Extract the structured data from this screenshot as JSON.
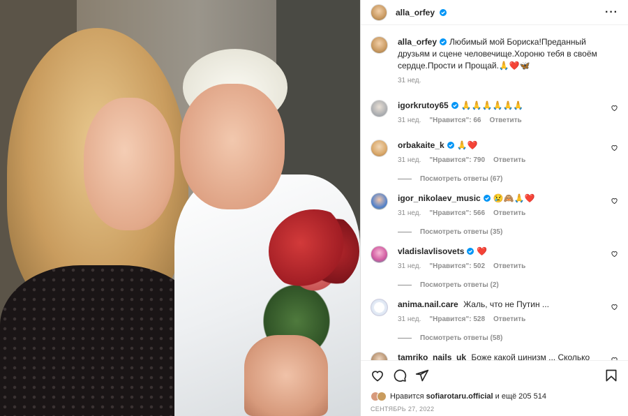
{
  "header": {
    "username": "alla_orfey",
    "more_icon": "more-horizontal-icon"
  },
  "caption": {
    "username": "alla_orfey",
    "text": "Любимый мой Бориска!Преданный друзьям и сцене человечище.Хороню тебя в своём сердце.Прости и Прощай.🙏❤️🦋",
    "time": "31 нед."
  },
  "comments": [
    {
      "username": "igorkrutoy65",
      "verified": true,
      "text": "🙏🙏🙏🙏🙏🙏",
      "time": "31 нед.",
      "likes": "\"Нравится\": 66",
      "reply": "Ответить"
    },
    {
      "username": "orbakaite_k",
      "verified": true,
      "text": "🙏❤️",
      "time": "31 нед.",
      "likes": "\"Нравится\": 790",
      "reply": "Ответить",
      "replies": "Посмотреть ответы (67)"
    },
    {
      "username": "igor_nikolaev_music",
      "verified": true,
      "text": "😢🙈🙏❤️",
      "time": "31 нед.",
      "likes": "\"Нравится\": 566",
      "reply": "Ответить",
      "replies": "Посмотреть ответы (35)"
    },
    {
      "username": "vladislavlisovets",
      "verified": true,
      "text": "❤️",
      "time": "31 нед.",
      "likes": "\"Нравится\": 502",
      "reply": "Ответить",
      "replies": "Посмотреть ответы (2)"
    },
    {
      "username": "anima.nail.care",
      "verified": false,
      "text": "Жаль, что не Путин ...",
      "time": "31 нед.",
      "likes": "\"Нравится\": 528",
      "reply": "Ответить",
      "replies": "Посмотреть ответы (58)"
    },
    {
      "username": "tamriko_nails_uk",
      "verified": false,
      "text": "Боже какой цинизм ... Сколько"
    }
  ],
  "footer": {
    "likes_prefix": "Нравится",
    "likes_user": "sofiarotaru.official",
    "likes_suffix": "и ещё 205 514",
    "date": "СЕНТЯБРЬ 27, 2022"
  },
  "colors": {
    "verified": "#0095f6",
    "text": "#262626",
    "muted": "#8e8e8e"
  }
}
